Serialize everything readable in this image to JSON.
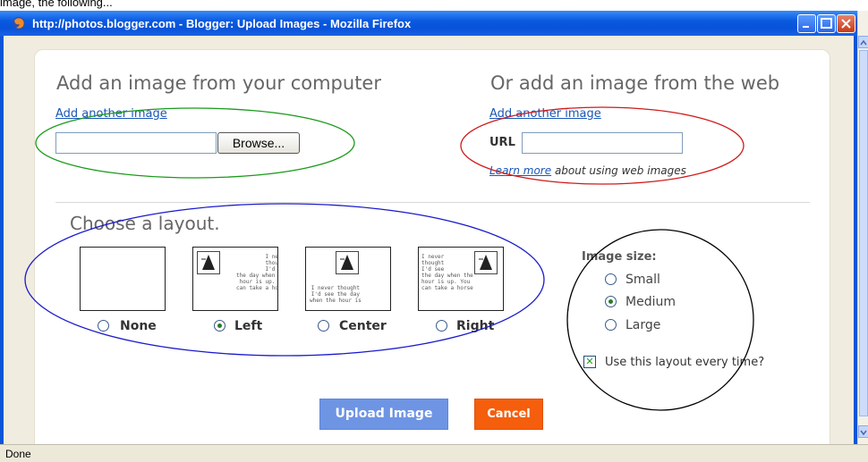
{
  "top_strip_text": "image, the following...",
  "window": {
    "title": "http://photos.blogger.com - Blogger: Upload Images - Mozilla Firefox"
  },
  "upload_computer": {
    "heading": "Add an image from your computer",
    "add_another_link": "Add another image",
    "browse_button": "Browse..."
  },
  "upload_web": {
    "heading": "Or add an image from the web",
    "add_another_link": "Add another image",
    "url_label": "URL",
    "learn_more_link": "Learn more",
    "learn_more_rest": " about using web images"
  },
  "layout": {
    "heading": "Choose a layout.",
    "options": [
      {
        "label": "None",
        "checked": false
      },
      {
        "label": "Left",
        "checked": true
      },
      {
        "label": "Center",
        "checked": false
      },
      {
        "label": "Right",
        "checked": false
      }
    ],
    "sample_text": {
      "left": "I never\nthought\nI'd see\nthe day when the\nhour is up. You\ncan take a horse",
      "center": "I never thought\nI'd see the day\nwhen the hour is",
      "right": "I never\nthought\nI'd see\nthe day when the\nhour is up. You\ncan take a horse"
    }
  },
  "image_size": {
    "title": "Image size:",
    "options": [
      {
        "label": "Small",
        "checked": false
      },
      {
        "label": "Medium",
        "checked": true
      },
      {
        "label": "Large",
        "checked": false
      }
    ]
  },
  "use_layout_checkbox": {
    "label": "Use this layout every time?",
    "checked": true,
    "mark": "✕"
  },
  "buttons": {
    "upload": "Upload Image",
    "cancel": "Cancel"
  },
  "status_text": "Done",
  "colors": {
    "titlebar": "#0a5ae0",
    "link": "#1a56b8",
    "upload_button": "#6e94e4",
    "cancel_button": "#f45e0d",
    "annotation_green": "#1a9a1a",
    "annotation_red": "#d11a1a",
    "annotation_blue": "#1a1acc",
    "annotation_black": "#000000"
  }
}
